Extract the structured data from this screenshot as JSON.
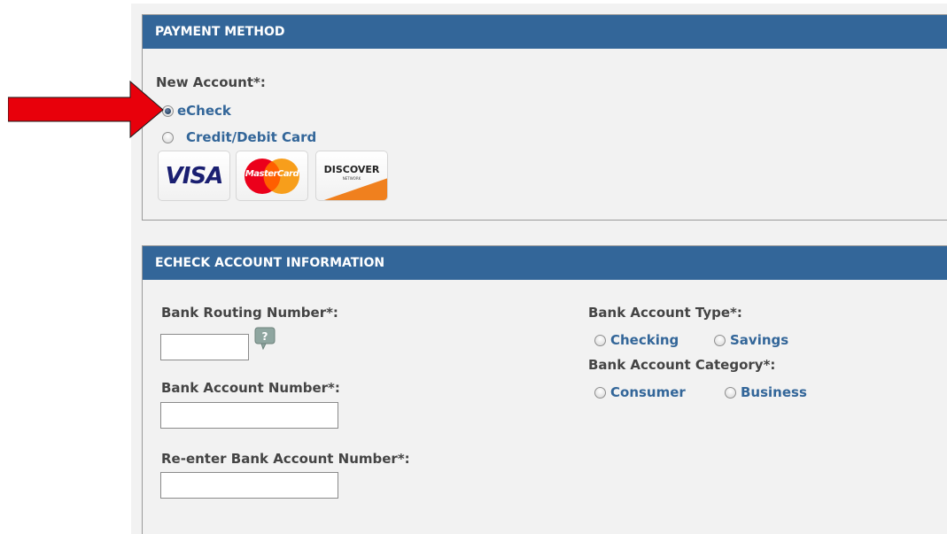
{
  "payment_method": {
    "header": "PAYMENT METHOD",
    "new_account_label": "New Account*:",
    "options": [
      {
        "label": "eCheck",
        "selected": true
      },
      {
        "label": "Credit/Debit Card",
        "selected": false
      }
    ],
    "card_logos": [
      "VISA",
      "MasterCard",
      "DISCOVER",
      "NETWORK"
    ]
  },
  "echeck_info": {
    "header": "ECHECK ACCOUNT INFORMATION",
    "routing_label": "Bank Routing Number*:",
    "routing_value": "",
    "account_number_label": "Bank Account Number*:",
    "account_number_value": "",
    "reenter_label": "Re-enter Bank Account Number*:",
    "reenter_value": "",
    "account_type_label": "Bank Account Type*:",
    "account_types": [
      {
        "label": "Checking",
        "selected": false
      },
      {
        "label": "Savings",
        "selected": false
      }
    ],
    "account_category_label": "Bank Account Category*:",
    "account_categories": [
      {
        "label": "Consumer",
        "selected": false
      },
      {
        "label": "Business",
        "selected": false
      }
    ]
  },
  "colors": {
    "header_bg": "#336699",
    "link_blue": "#336699",
    "arrow_red": "#e8000b"
  }
}
